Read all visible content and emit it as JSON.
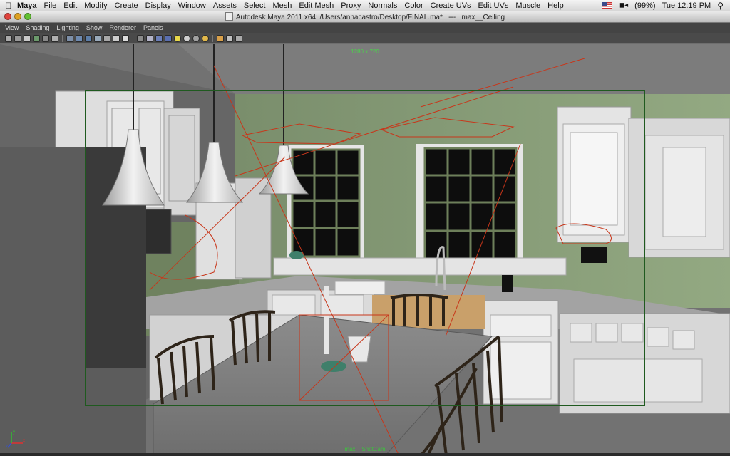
{
  "menubar": {
    "app_name": "Maya",
    "items": [
      "File",
      "Edit",
      "Modify",
      "Create",
      "Display",
      "Window",
      "Assets",
      "Select",
      "Mesh",
      "Edit Mesh",
      "Proxy",
      "Normals",
      "Color",
      "Create UVs",
      "Edit UVs",
      "Muscle",
      "Help"
    ],
    "battery": "(99%)",
    "clock": "Tue 12:19 PM"
  },
  "window": {
    "title": "Autodesk Maya 2011 x64: /Users/annacastro/Desktop/FINAL.ma*   ---   max__Ceiling"
  },
  "panel_menu": {
    "items": [
      "View",
      "Shading",
      "Lighting",
      "Show",
      "Renderer",
      "Panels"
    ]
  },
  "viewport": {
    "resolution_label": "1280 x 720",
    "camera_label": "max__ShotCam"
  },
  "colors": {
    "wall_green": "#8ea47c",
    "gate_green": "#1f5a1f",
    "light_wire": "#c8361a",
    "cabinet_white": "#e6e6e6",
    "counter_grey": "#9a9a9a"
  }
}
